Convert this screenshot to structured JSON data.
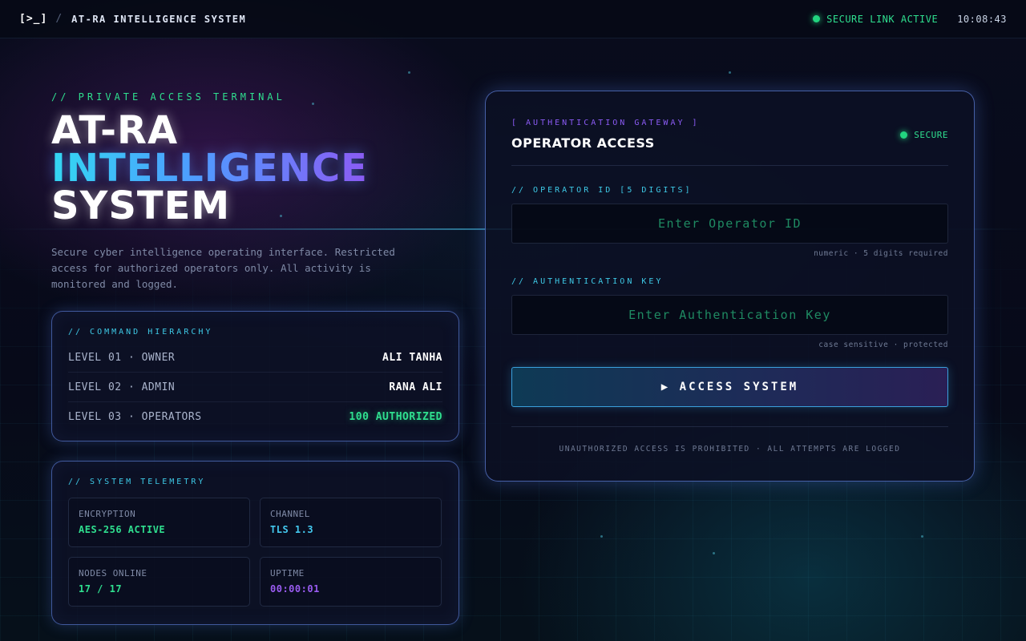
{
  "topbar": {
    "logo": "[>_]",
    "separator": "/",
    "title": "AT-RA INTELLIGENCE SYSTEM",
    "status": "SECURE LINK ACTIVE",
    "time": "10:08:43"
  },
  "hero": {
    "kicker": "// PRIVATE ACCESS TERMINAL",
    "line1": "AT-RA",
    "line2": "INTELLIGENCE",
    "line3": "SYSTEM",
    "description": "Secure cyber intelligence operating interface. Restricted access for authorized operators only. All activity is monitored and logged."
  },
  "hierarchy": {
    "title": "// COMMAND HIERARCHY",
    "rows": [
      {
        "level": "LEVEL 01 · OWNER",
        "value": "ALI TANHA"
      },
      {
        "level": "LEVEL 02 · ADMIN",
        "value": "RANA ALI"
      },
      {
        "level": "LEVEL 03 · OPERATORS",
        "value": "100 AUTHORIZED"
      }
    ]
  },
  "telemetry": {
    "title": "// SYSTEM TELEMETRY",
    "tiles": [
      {
        "label": "ENCRYPTION",
        "value": "AES-256 ACTIVE"
      },
      {
        "label": "CHANNEL",
        "value": "TLS 1.3"
      },
      {
        "label": "NODES ONLINE",
        "value": "17 / 17"
      },
      {
        "label": "UPTIME",
        "value": "00:00:01"
      }
    ]
  },
  "auth": {
    "kicker": "[ AUTHENTICATION GATEWAY ]",
    "title": "OPERATOR ACCESS",
    "status": "SECURE",
    "operator_label": "// OPERATOR ID [5 DIGITS]",
    "operator_value": "",
    "operator_placeholder": "Enter Operator ID",
    "operator_hint": "numeric · 5 digits required",
    "key_label": "// AUTHENTICATION KEY",
    "key_value": "",
    "key_placeholder": "Enter Authentication Key",
    "key_hint": "case sensitive · protected",
    "button": "▶ ACCESS SYSTEM",
    "footer": "UNAUTHORIZED ACCESS IS PROHIBITED · ALL ATTEMPTS ARE LOGGED"
  },
  "colors": {
    "accent_green": "#2fdf8f",
    "accent_cyan": "#3ec9e6",
    "accent_purple": "#8b5bf4",
    "background": "#060a17"
  }
}
